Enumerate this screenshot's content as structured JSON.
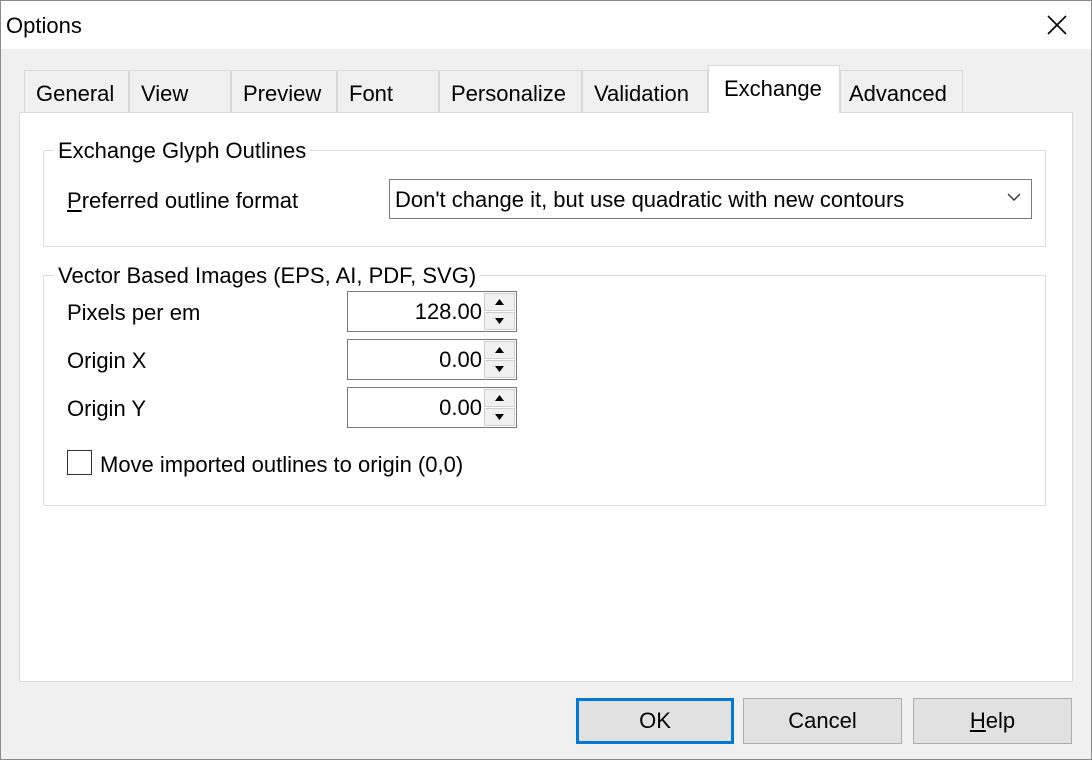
{
  "window": {
    "title": "Options"
  },
  "tabs": [
    {
      "label": "General"
    },
    {
      "label": "View"
    },
    {
      "label": "Preview"
    },
    {
      "label": "Font"
    },
    {
      "label": "Personalize"
    },
    {
      "label": "Validation"
    },
    {
      "label": "Exchange",
      "active": true
    },
    {
      "label": "Advanced"
    }
  ],
  "exchange_outlines": {
    "title": "Exchange Glyph Outlines",
    "preferred_label_mnemonic": "P",
    "preferred_label_rest": "referred outline format",
    "preferred_value": "Don't change it, but use quadratic with new contours"
  },
  "vector_images": {
    "title": "Vector Based Images (EPS, AI, PDF, SVG)",
    "pixels_per_em_label": "Pixels per em",
    "pixels_per_em_value": "128.00",
    "origin_x_label": "Origin X",
    "origin_x_value": "0.00",
    "origin_y_label": "Origin Y",
    "origin_y_value": "0.00",
    "move_to_origin_label": "Move imported outlines to origin (0,0)",
    "move_to_origin_checked": false
  },
  "buttons": {
    "ok": "OK",
    "cancel": "Cancel",
    "help_mnemonic": "H",
    "help_rest": "elp"
  },
  "colors": {
    "accent": "#0078d7",
    "panel": "#ffffff",
    "chrome": "#f0f0f0"
  },
  "icons": {
    "close": "close-icon",
    "dropdown": "chevron-down-icon",
    "spin_up": "spin-up-icon",
    "spin_down": "spin-down-icon"
  }
}
